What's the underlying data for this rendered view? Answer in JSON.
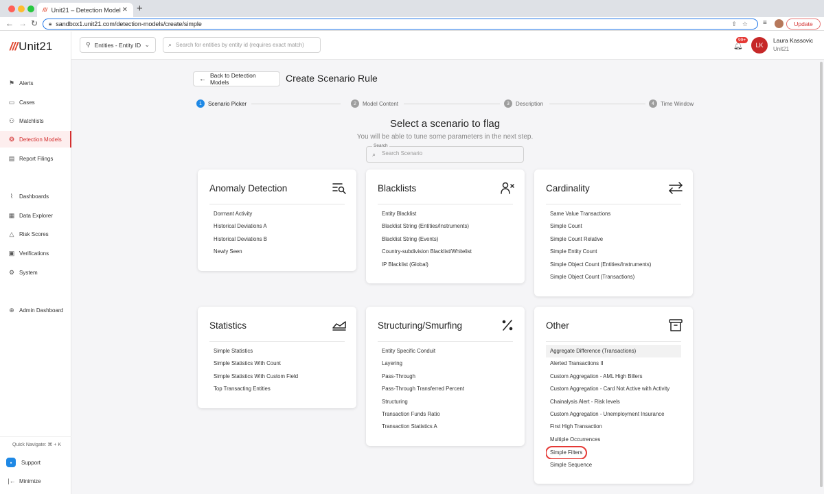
{
  "browser": {
    "tab_title": "Unit21 – Detection Model",
    "url": "sandbox1.unit21.com/detection-models/create/simple",
    "update_label": "Update"
  },
  "sidebar": {
    "logo": "Unit21",
    "items": [
      {
        "label": "Alerts",
        "icon": "flag-icon"
      },
      {
        "label": "Cases",
        "icon": "briefcase-icon"
      },
      {
        "label": "Matchlists",
        "icon": "user-plus-icon"
      },
      {
        "label": "Detection Models",
        "icon": "brain-icon"
      },
      {
        "label": "Report Filings",
        "icon": "document-icon"
      },
      {
        "label": "Dashboards",
        "icon": "chart-icon"
      },
      {
        "label": "Data Explorer",
        "icon": "table-icon"
      },
      {
        "label": "Risk Scores",
        "icon": "warning-icon"
      },
      {
        "label": "Verifications",
        "icon": "id-card-icon"
      },
      {
        "label": "System",
        "icon": "gear-icon"
      },
      {
        "label": "Admin Dashboard",
        "icon": "globe-icon"
      }
    ],
    "quick_navigate": "Quick Navigate: ⌘ + K",
    "support": "Support",
    "minimize": "Minimize"
  },
  "header": {
    "entity_select": "Entities - Entity ID",
    "search_placeholder": "Search for entities by entity id (requires exact match)",
    "notification_count": "99+",
    "user_initials": "LK",
    "user_name": "Laura Kassovic",
    "user_org": "Unit21"
  },
  "page": {
    "back_label": "Back to Detection Models",
    "title": "Create Scenario Rule",
    "steps": [
      {
        "num": "1",
        "label": "Scenario Picker"
      },
      {
        "num": "2",
        "label": "Model Content"
      },
      {
        "num": "3",
        "label": "Description"
      },
      {
        "num": "4",
        "label": "Time Window"
      }
    ],
    "heading": "Select a scenario to flag",
    "subheading": "You will be able to tune some parameters in the next step.",
    "search_label": "Search",
    "search_placeholder": "Search Scenario"
  },
  "cards": [
    {
      "title": "Anomaly Detection",
      "items": [
        "Dormant Activity",
        "Historical Deviations A",
        "Historical Deviations B",
        "Newly Seen"
      ]
    },
    {
      "title": "Blacklists",
      "items": [
        "Entity Blacklist",
        "Blacklist String (Entities/Instruments)",
        "Blacklist String (Events)",
        "Country-subdivision Blacklist/Whitelist",
        "IP Blacklist (Global)"
      ]
    },
    {
      "title": "Cardinality",
      "items": [
        "Same Value Transactions",
        "Simple Count",
        "Simple Count Relative",
        "Simple Entity Count",
        "Simple Object Count (Entities/Instruments)",
        "Simple Object Count (Transactions)"
      ]
    },
    {
      "title": "Statistics",
      "items": [
        "Simple Statistics",
        "Simple Statistics With Count",
        "Simple Statistics With Custom Field",
        "Top Transacting Entities"
      ]
    },
    {
      "title": "Structuring/Smurfing",
      "items": [
        "Entity Specific Conduit",
        "Layering",
        "Pass-Through",
        "Pass-Through Transferred Percent",
        "Structuring",
        "Transaction Funds Ratio",
        "Transaction Statistics A"
      ]
    },
    {
      "title": "Other",
      "items": [
        "Aggregate Difference (Transactions)",
        "Alerted Transactions II",
        "Custom Aggregation - AML High Billers",
        "Custom Aggregation - Card Not Active with Activity",
        "Chainalysis Alert - Risk levels",
        "Custom Aggregation - Unemployment Insurance",
        "First High Transaction",
        "Multiple Occurrences",
        "Simple Filters",
        "Simple Sequence"
      ]
    }
  ]
}
